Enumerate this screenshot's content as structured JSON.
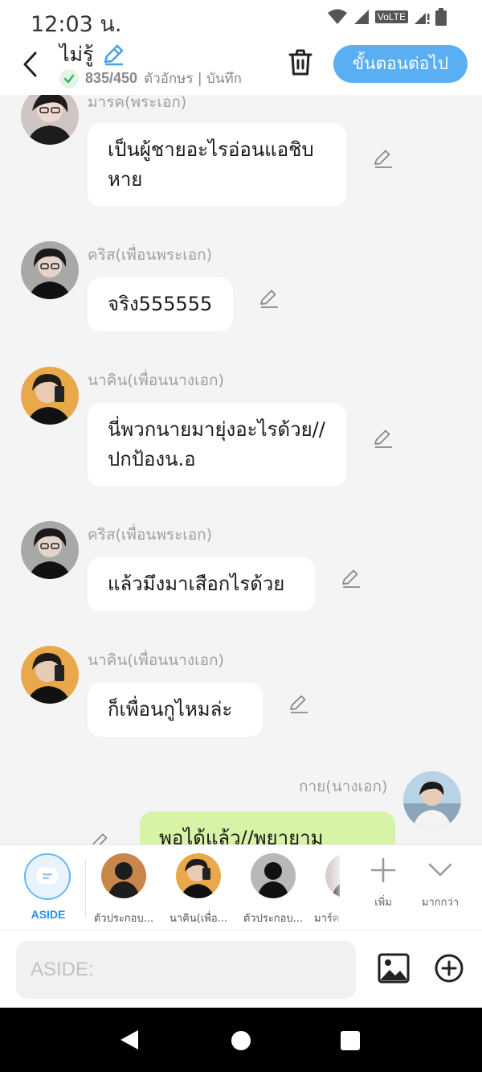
{
  "status_bar": {
    "time": "12:03 น.",
    "volte": "VoLTE"
  },
  "header": {
    "title": "ไม่รู้",
    "char_count": "835/450",
    "save_text": "ตัวอักษร | บันทึก",
    "next_button": "ขั้นตอนต่อไป"
  },
  "messages": [
    {
      "sender": "มารค(พระเอก)",
      "text": "เป็นผู้ชายอะไรอ่อนแอชิบหาย"
    },
    {
      "sender": "คริส(เพื่อนพระเอก)",
      "text": "จริง555555"
    },
    {
      "sender": "นาคิน(เพื่อนนางเอก)",
      "text": "นี่พวกนายมายุ่งอะไรด้วย//ปกป้องน.อ"
    },
    {
      "sender": "คริส(เพื่อนพระเอก)",
      "text": "แล้วมึงมาเสือกไรด้วย"
    },
    {
      "sender": "นาคิน(เพื่อนนางเอก)",
      "text": "ก็เพื่อนกูไหมล่ะ"
    },
    {
      "sender": "กาย(นางเอก)",
      "text": "พอได้แล้ว//พยายาม"
    }
  ],
  "character_strip": {
    "aside_label": "ASIDE",
    "characters": [
      {
        "label": "ตัวประกอบ..."
      },
      {
        "label": "นาคิน(เพื่อ..."
      },
      {
        "label": "ตัวประกอบ..."
      },
      {
        "label": "มาร์ค"
      }
    ],
    "add_label": "เพิ่ม",
    "more_label": "มากกว่า"
  },
  "input": {
    "placeholder": "ASIDE:"
  },
  "colors": {
    "accent": "#5aaef2",
    "right_bubble": "#d6f3a6",
    "left_bubble": "#ffffff"
  }
}
